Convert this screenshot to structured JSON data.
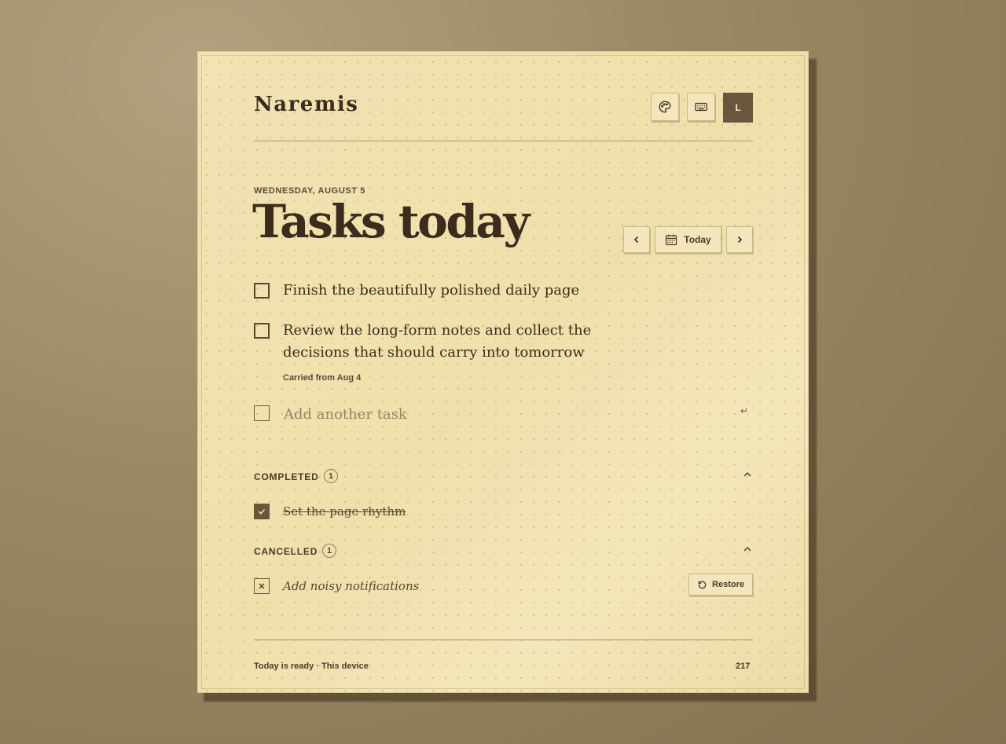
{
  "app": {
    "name": "Naremis"
  },
  "header": {
    "theme_icon": "palette-icon",
    "shortcuts_icon": "keyboard-icon",
    "avatar_initial": "L"
  },
  "day": {
    "date_label": "WEDNESDAY, AUGUST 5",
    "title": "Tasks today",
    "today_label": "Today"
  },
  "tasks": [
    {
      "text": "Finish the beautifully polished daily page",
      "note": ""
    },
    {
      "text": "Review the long-form notes and collect the decisions that should carry into tomorrow",
      "note": "Carried from Aug 4"
    }
  ],
  "add_task": {
    "placeholder": "Add another task",
    "enter_hint": "↵"
  },
  "completed": {
    "title": "COMPLETED",
    "count": "1",
    "items": [
      "Set the page rhythm"
    ]
  },
  "cancelled": {
    "title": "CANCELLED",
    "count": "1",
    "items": [
      "Add noisy notifications"
    ],
    "restore_label": "Restore"
  },
  "footer": {
    "status": "Today is ready · This device",
    "count": "217"
  },
  "colors": {
    "paper": "#efe0ac",
    "ink": "#3b2c1e",
    "accent": "#6b553d",
    "background": "#9a8762"
  }
}
